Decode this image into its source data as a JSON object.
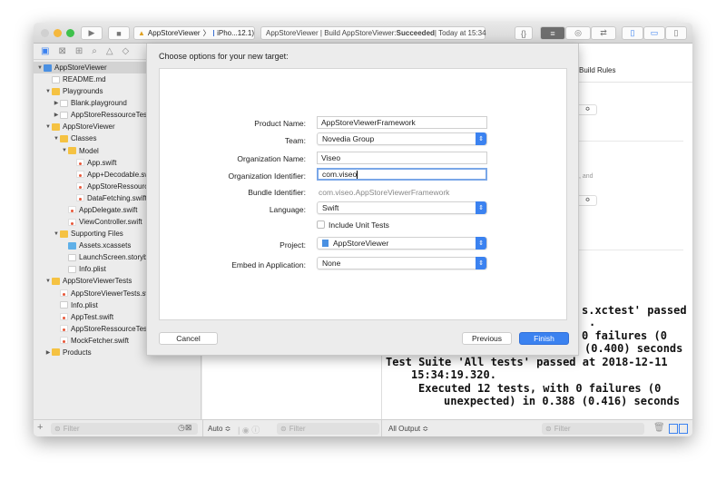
{
  "toolbar": {
    "scheme": "AppStoreViewer",
    "device": "iPho...12.1)",
    "status_prefix": "AppStoreViewer | Build AppStoreViewer: ",
    "status_bold": "Succeeded",
    "status_suffix": " | Today at 15:34"
  },
  "navigator": {
    "items": [
      {
        "label": "AppStoreViewer",
        "icon": "proj",
        "depth": 0,
        "tri": "▼",
        "selected": true
      },
      {
        "label": "README.md",
        "icon": "file",
        "depth": 1,
        "tri": ""
      },
      {
        "label": "Playgrounds",
        "icon": "folder",
        "depth": 1,
        "tri": "▼"
      },
      {
        "label": "Blank.playground",
        "icon": "file",
        "depth": 2,
        "tri": "▶"
      },
      {
        "label": "AppStoreRessourceTest",
        "icon": "file",
        "depth": 2,
        "tri": "▶"
      },
      {
        "label": "AppStoreViewer",
        "icon": "folder",
        "depth": 1,
        "tri": "▼"
      },
      {
        "label": "Classes",
        "icon": "folder",
        "depth": 2,
        "tri": "▼"
      },
      {
        "label": "Model",
        "icon": "folder",
        "depth": 3,
        "tri": "▼"
      },
      {
        "label": "App.swift",
        "icon": "swift",
        "depth": 4,
        "tri": ""
      },
      {
        "label": "App+Decodable.swift",
        "icon": "swift",
        "depth": 4,
        "tri": ""
      },
      {
        "label": "AppStoreRessource.swift",
        "icon": "swift",
        "depth": 4,
        "tri": ""
      },
      {
        "label": "DataFetching.swift",
        "icon": "swift",
        "depth": 4,
        "tri": ""
      },
      {
        "label": "AppDelegate.swift",
        "icon": "swift",
        "depth": 3,
        "tri": ""
      },
      {
        "label": "ViewController.swift",
        "icon": "swift",
        "depth": 3,
        "tri": ""
      },
      {
        "label": "Supporting Files",
        "icon": "folder",
        "depth": 2,
        "tri": "▼"
      },
      {
        "label": "Assets.xcassets",
        "icon": "assets",
        "depth": 3,
        "tri": ""
      },
      {
        "label": "LaunchScreen.storyboard",
        "icon": "file",
        "depth": 3,
        "tri": ""
      },
      {
        "label": "Info.plist",
        "icon": "file",
        "depth": 3,
        "tri": ""
      },
      {
        "label": "AppStoreViewerTests",
        "icon": "folder",
        "depth": 1,
        "tri": "▼"
      },
      {
        "label": "AppStoreViewerTests.swift",
        "icon": "swift",
        "depth": 2,
        "tri": ""
      },
      {
        "label": "Info.plist",
        "icon": "file",
        "depth": 2,
        "tri": ""
      },
      {
        "label": "AppTest.swift",
        "icon": "swift",
        "depth": 2,
        "tri": ""
      },
      {
        "label": "AppStoreRessourceTest.swift",
        "icon": "swift",
        "depth": 2,
        "tri": ""
      },
      {
        "label": "MockFetcher.swift",
        "icon": "swift",
        "depth": 2,
        "tri": ""
      },
      {
        "label": "Products",
        "icon": "folder",
        "depth": 1,
        "tri": "▶"
      }
    ],
    "filter_placeholder": "Filter"
  },
  "editor": {
    "tab_build_rules": "Build Rules",
    "partial_text": ", and"
  },
  "sheet": {
    "title": "Choose options for your new target:",
    "product_name_label": "Product Name:",
    "product_name": "AppStoreViewerFramework",
    "team_label": "Team:",
    "team": "Novedia Group",
    "org_name_label": "Organization Name:",
    "org_name": "Viseo",
    "org_id_label": "Organization Identifier:",
    "org_id": "com.viseo",
    "bundle_label": "Bundle Identifier:",
    "bundle": "com.viseo.AppStoreViewerFramework",
    "language_label": "Language:",
    "language": "Swift",
    "unit_tests_label": "Include Unit Tests",
    "unit_tests_checked": false,
    "project_label": "Project:",
    "project": "AppStoreViewer",
    "embed_label": "Embed in Application:",
    "embed": "None",
    "cancel": "Cancel",
    "previous": "Previous",
    "finish": "Finish",
    "accent": "#3b82f0"
  },
  "console": {
    "lines": [
      "s.xctest' passed",
      ".",
      "0 failures (0",
      "(0.400) seconds",
      "Test Suite 'All tests' passed at 2018-12-11",
      "15:34:19.320.",
      "Executed 12 tests, with 0 failures (0",
      "unexpected) in 0.388 (0.416) seconds"
    ]
  },
  "bottom": {
    "auto": "Auto ≎",
    "filter": "Filter",
    "all_output": "All Output ≎"
  }
}
